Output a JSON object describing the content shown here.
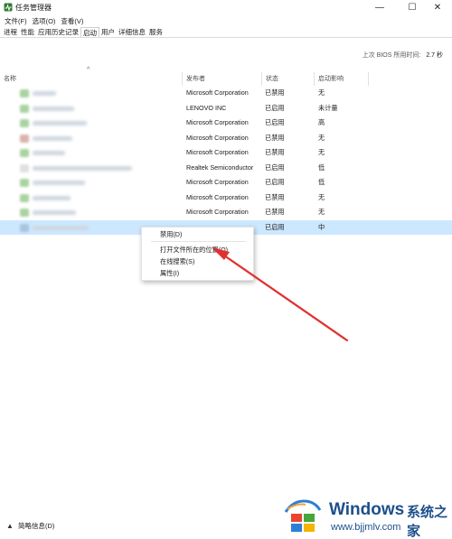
{
  "window": {
    "title": "任务管理器",
    "minimize": "—",
    "maximize": "☐",
    "close": "✕"
  },
  "menu": [
    "文件(F)",
    "选项(O)",
    "查看(V)"
  ],
  "tabs": [
    "进程",
    "性能",
    "应用历史记录",
    "启动",
    "用户",
    "详细信息",
    "服务"
  ],
  "active_tab": "启动",
  "bios": {
    "label": "上次 BIOS 所用时间:",
    "value": "2.7 秒"
  },
  "columns": {
    "name": "名称",
    "publisher": "发布者",
    "status": "状态",
    "impact": "启动影响"
  },
  "sort_arrow": "^",
  "rows": [
    {
      "publisher": "Microsoft Corporation",
      "status": "已禁用",
      "impact": "无"
    },
    {
      "publisher": "LENOVO INC",
      "status": "已启用",
      "impact": "未计量"
    },
    {
      "publisher": "Microsoft Corporation",
      "status": "已启用",
      "impact": "高"
    },
    {
      "publisher": "Microsoft Corporation",
      "status": "已禁用",
      "impact": "无"
    },
    {
      "publisher": "Microsoft Corporation",
      "status": "已禁用",
      "impact": "无"
    },
    {
      "publisher": "Realtek Semiconductor",
      "status": "已启用",
      "impact": "低"
    },
    {
      "publisher": "Microsoft Corporation",
      "status": "已启用",
      "impact": "低"
    },
    {
      "publisher": "Microsoft Corporation",
      "status": "已禁用",
      "impact": "无"
    },
    {
      "publisher": "Microsoft Corporation",
      "status": "已禁用",
      "impact": "无"
    },
    {
      "publisher": "",
      "status": "已启用",
      "impact": "中"
    }
  ],
  "context_menu": [
    "禁用(D)",
    "打开文件所在的位置(O)",
    "在线搜索(S)",
    "属性(I)"
  ],
  "footer": {
    "label": "简略信息(D)"
  },
  "watermark": {
    "brand": "Windows",
    "cn": "系统之家",
    "url": "www.bjjmlv.com"
  },
  "colors": {
    "selected_row": "#cce8ff",
    "arrow": "#e0322f",
    "watermark": "#1d4f8c"
  }
}
